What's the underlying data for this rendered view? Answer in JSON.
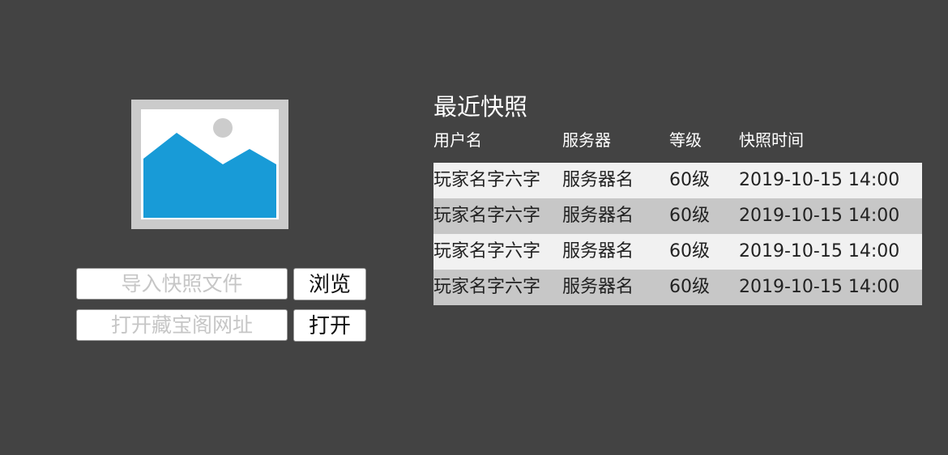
{
  "left_panel": {
    "preview_image_icon": "image-placeholder-icon",
    "import_input": {
      "value": "",
      "placeholder": "导入快照文件"
    },
    "browse_button_label": "浏览",
    "url_input": {
      "value": "",
      "placeholder": "打开藏宝阁网址"
    },
    "open_button_label": "打开"
  },
  "recent_snapshots": {
    "title": "最近快照",
    "columns": {
      "username": "用户名",
      "server": "服务器",
      "level": "等级",
      "snapshot_time": "快照时间"
    },
    "rows": [
      {
        "username": "玩家名字六字",
        "server": "服务器名",
        "level": "60级",
        "snapshot_time": "2019-10-15 14:00"
      },
      {
        "username": "玩家名字六字",
        "server": "服务器名",
        "level": "60级",
        "snapshot_time": "2019-10-15 14:00"
      },
      {
        "username": "玩家名字六字",
        "server": "服务器名",
        "level": "60级",
        "snapshot_time": "2019-10-15 14:00"
      },
      {
        "username": "玩家名字六字",
        "server": "服务器名",
        "level": "60级",
        "snapshot_time": "2019-10-15 14:00"
      }
    ]
  },
  "colors": {
    "background": "#434343",
    "image_frame": "#cbcbcb",
    "image_mountains": "#189bd7",
    "image_sun": "#cccccc",
    "row_light": "#f1f1f1",
    "row_dark": "#c7c7c7"
  }
}
